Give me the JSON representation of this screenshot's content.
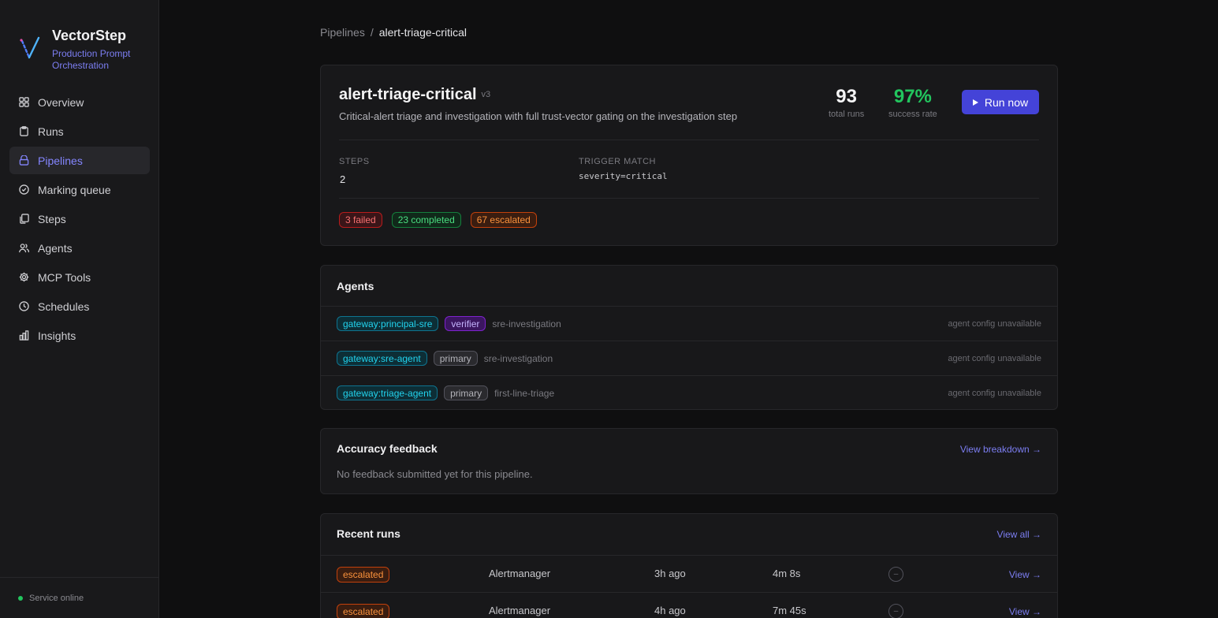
{
  "brand": {
    "name": "VectorStep",
    "tagline": "Production Prompt Orchestration"
  },
  "nav": [
    {
      "label": "Overview",
      "icon": "grid-icon",
      "active": false
    },
    {
      "label": "Runs",
      "icon": "clipboard-icon",
      "active": false
    },
    {
      "label": "Pipelines",
      "icon": "layers-icon",
      "active": true
    },
    {
      "label": "Marking queue",
      "icon": "check-circle-icon",
      "active": false
    },
    {
      "label": "Steps",
      "icon": "copy-icon",
      "active": false
    },
    {
      "label": "Agents",
      "icon": "users-icon",
      "active": false
    },
    {
      "label": "MCP Tools",
      "icon": "gear-icon",
      "active": false
    },
    {
      "label": "Schedules",
      "icon": "clock-icon",
      "active": false
    },
    {
      "label": "Insights",
      "icon": "bar-chart-icon",
      "active": false
    }
  ],
  "service_status": "Service online",
  "breadcrumb": {
    "parent": "Pipelines",
    "separator": "/",
    "current": "alert-triage-critical"
  },
  "pipeline": {
    "name": "alert-triage-critical",
    "version": "v3",
    "description": "Critical-alert triage and investigation with full trust-vector gating on the investigation step",
    "total_runs": "93",
    "total_runs_label": "total runs",
    "success_rate": "97%",
    "success_rate_label": "success rate",
    "run_button": "Run now",
    "steps_label": "STEPS",
    "steps_value": "2",
    "trigger_label": "TRIGGER MATCH",
    "trigger_value": "severity=critical",
    "status_counts": {
      "failed": "3 failed",
      "completed": "23 completed",
      "escalated": "67 escalated"
    }
  },
  "agents": {
    "title": "Agents",
    "rows": [
      {
        "gateway": "gateway:principal-sre",
        "role": "verifier",
        "context": "sre-investigation",
        "note": "agent config unavailable"
      },
      {
        "gateway": "gateway:sre-agent",
        "role": "primary",
        "context": "sre-investigation",
        "note": "agent config unavailable"
      },
      {
        "gateway": "gateway:triage-agent",
        "role": "primary",
        "context": "first-line-triage",
        "note": "agent config unavailable"
      }
    ]
  },
  "accuracy": {
    "title": "Accuracy feedback",
    "link": "View breakdown →",
    "empty": "No feedback submitted yet for this pipeline."
  },
  "recent_runs": {
    "title": "Recent runs",
    "link": "View all →",
    "rows": [
      {
        "status": "escalated",
        "source": "Alertmanager",
        "time": "3h ago",
        "duration": "4m 8s",
        "marker": "–",
        "action": "View →"
      },
      {
        "status": "escalated",
        "source": "Alertmanager",
        "time": "4h ago",
        "duration": "7m 45s",
        "marker": "–",
        "action": "View →"
      }
    ]
  },
  "colors": {
    "accent": "#4443d8",
    "success": "#22c55e",
    "link": "#7c7ef2"
  }
}
